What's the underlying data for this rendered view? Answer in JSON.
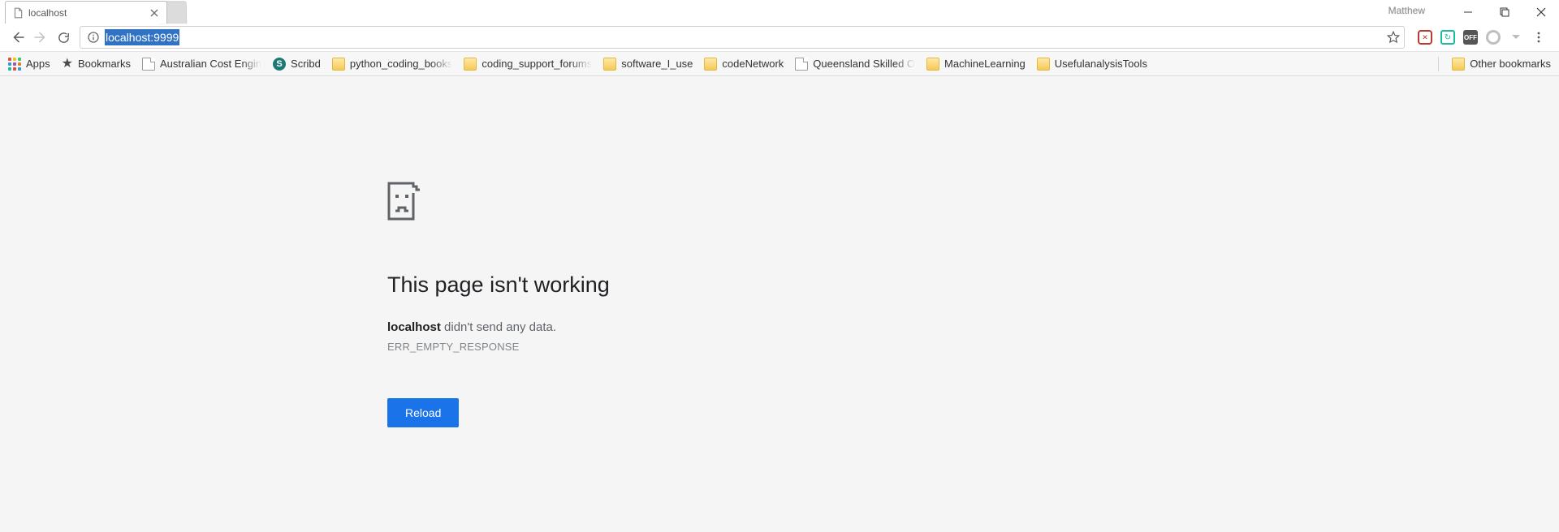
{
  "window": {
    "profile_name": "Matthew"
  },
  "tab": {
    "title": "localhost"
  },
  "omnibox": {
    "url": "localhost:9999"
  },
  "extensions": {
    "off_label": "OFF"
  },
  "bookmarks": {
    "apps_label": "Apps",
    "items": [
      {
        "label": "Bookmarks"
      },
      {
        "label": "Australian Cost Engin"
      },
      {
        "label": "Scribd"
      },
      {
        "label": "python_coding_books"
      },
      {
        "label": "coding_support_forums"
      },
      {
        "label": "software_I_use"
      },
      {
        "label": "codeNetwork"
      },
      {
        "label": "Queensland Skilled O"
      },
      {
        "label": "MachineLearning"
      },
      {
        "label": "UsefulanalysisTools"
      }
    ],
    "other_label": "Other bookmarks"
  },
  "error": {
    "title": "This page isn't working",
    "host": "localhost",
    "message_suffix": " didn't send any data.",
    "code": "ERR_EMPTY_RESPONSE",
    "reload_label": "Reload"
  }
}
